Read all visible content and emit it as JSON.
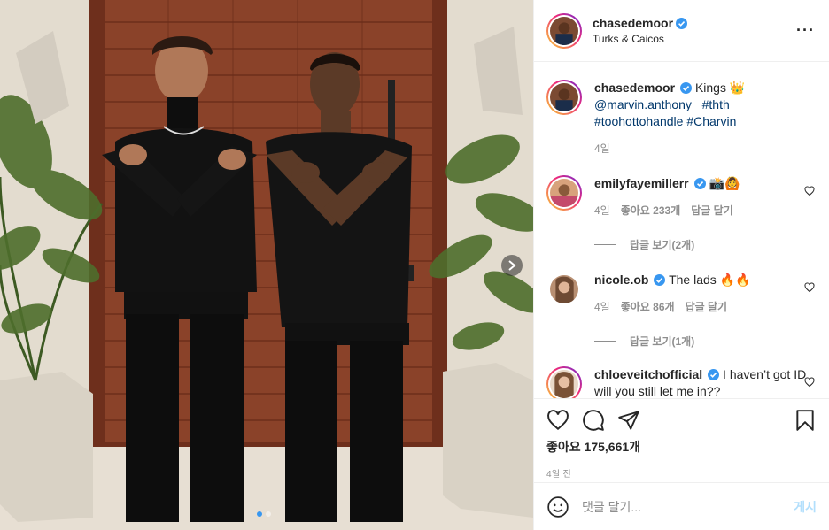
{
  "header": {
    "username": "chasedemoor",
    "location": "Turks & Caicos",
    "more_icon": "more-horizontal-icon"
  },
  "caption": {
    "username": "chasedemoor",
    "text": "Kings 👑",
    "mention": "@marvin.anthony_",
    "hashtags": [
      "#thth",
      "#toohottohandle",
      "#Charvin"
    ],
    "time": "4일"
  },
  "comments": [
    {
      "username": "emilyfayemillerr",
      "text": "📸🙆",
      "time": "4일",
      "likes": "좋아요 233개",
      "reply": "답글 달기",
      "view_replies": "답글 보기(2개)"
    },
    {
      "username": "nicole.ob",
      "text": "The lads 🔥🔥",
      "time": "4일",
      "likes": "좋아요 86개",
      "reply": "답글 달기",
      "view_replies": "답글 보기(1개)"
    },
    {
      "username": "chloeveitchofficial",
      "text": "I haven’t got ID will you still let me in??"
    }
  ],
  "actions": {
    "likes": "좋아요 175,661개",
    "time": "4일 전"
  },
  "add_comment": {
    "placeholder": "댓글 달기...",
    "post_label": "게시"
  },
  "colors": {
    "verified": "#3897f0",
    "link": "#00376b",
    "muted": "#8e8e8e",
    "post_disabled": "#b2dffc"
  },
  "carousel": {
    "current": 1,
    "total": 2
  }
}
